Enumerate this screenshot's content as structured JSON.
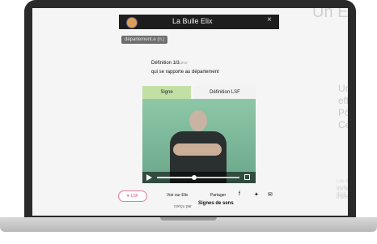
{
  "background": {
    "heading": "Un Explicatio",
    "line1": "Un annuaire collaboratif pour",
    "line2": "effectuer vos recherches : CRI, AgefIph,",
    "line3": "Pôle Emploi, Professionnels ICCAT, EqLAAT,",
    "line4": "Centre ressources...",
    "small1": "Les ICCAT sont les professionnels engagés qui ont le droit",
    "small2": "Iris des services fournit aux personnes sourdes et aux clients",
    "small3": "d'accéder sociaux au travail."
  },
  "popup": {
    "title": "La Bulle Elix",
    "close_label": "×",
    "logo_icon": "logo-circle-icon",
    "dept_tag": "département.e (n.)",
    "definition_heading": "Définition 1/1",
    "definition_source": "Source",
    "definition_text": "qui se rapporte au département",
    "tabs": {
      "signe": "Signe",
      "definition_lsf": "Définition LSF"
    },
    "video": {
      "progress_ratio": 0.45
    },
    "actions": {
      "pill_label": "LSF",
      "pill_icon": "heart-icon",
      "voir_label": "Voir sur Elix",
      "partager_label": "Partager",
      "share_icons": [
        "facebook-icon",
        "twitter-icon",
        "email-icon"
      ]
    },
    "footer": {
      "left": "conçu par",
      "brand": "Signes de sens"
    }
  },
  "colors": {
    "accent_green": "#c2e0a4",
    "pink": "#e37b9b",
    "titlebar": "#1d1d1d"
  }
}
